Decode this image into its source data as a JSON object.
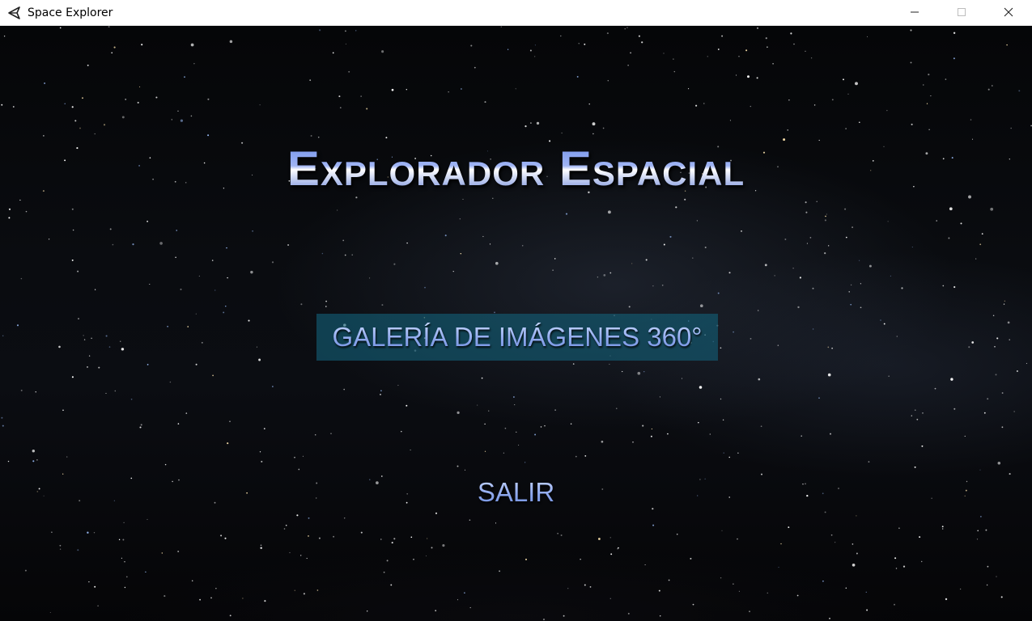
{
  "window": {
    "title": "Space Explorer",
    "app_icon": "unity-icon",
    "controls": [
      "minimize-icon",
      "maximize-icon",
      "close-icon"
    ]
  },
  "main_menu": {
    "title": "Explorador Espacial",
    "buttons": {
      "gallery_label": "GALERÍA DE IMÁGENES 360°",
      "exit_label": "SALIR"
    }
  },
  "colors": {
    "title_gradient_start": "#6f8fe8",
    "button_highlight": "#145f78",
    "titlebar_bg": "#ffffff"
  }
}
